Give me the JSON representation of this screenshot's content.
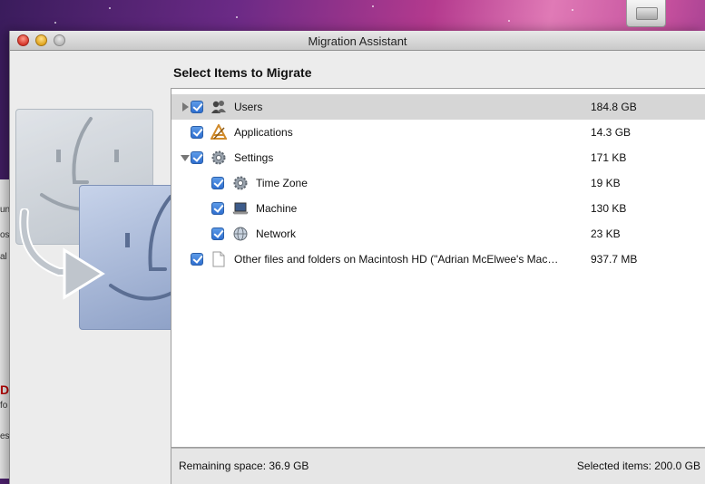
{
  "window": {
    "title": "Migration Assistant"
  },
  "page": {
    "heading": "Select Items to Migrate"
  },
  "items": [
    {
      "label": "Users",
      "size": "184.8 GB",
      "icon": "users-icon",
      "checked": true,
      "disclosure": "collapsed",
      "selected": true
    },
    {
      "label": "Applications",
      "size": "14.3 GB",
      "icon": "applications-icon",
      "checked": true
    },
    {
      "label": "Settings",
      "size": "171 KB",
      "icon": "gear-icon",
      "checked": true,
      "disclosure": "expanded"
    },
    {
      "label": "Time Zone",
      "size": "19 KB",
      "icon": "gear-icon",
      "checked": true
    },
    {
      "label": "Machine",
      "size": "130 KB",
      "icon": "laptop-icon",
      "checked": true
    },
    {
      "label": "Network",
      "size": "23 KB",
      "icon": "globe-icon",
      "checked": true
    },
    {
      "label": "Other files and folders on Macintosh HD (\"Adrian McElwee's Mac…",
      "size": "937.7 MB",
      "icon": "document-icon",
      "checked": true
    }
  ],
  "footer": {
    "remaining": "Remaining space: 36.9 GB",
    "selected": "Selected items: 200.0 GB"
  },
  "background_window": {
    "fragments": [
      "un",
      "os",
      "al",
      "D",
      "fo",
      "es"
    ]
  },
  "colors": {
    "checkbox": "#3b7fdc",
    "selected_row": "#d6d6d6",
    "close": "#d5372b",
    "minimize": "#e0a51f"
  }
}
